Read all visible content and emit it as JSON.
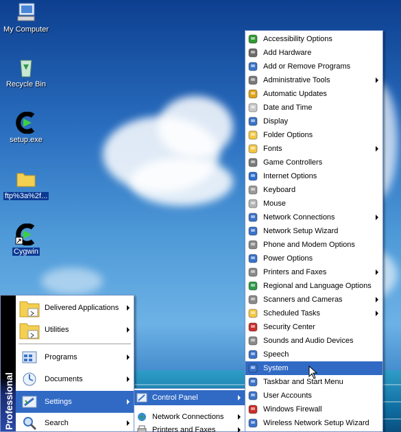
{
  "desktop": {
    "icons": [
      {
        "label": "My Computer",
        "icon": "my-computer-icon",
        "selected": false
      },
      {
        "label": "Recycle Bin",
        "icon": "recycle-bin-icon",
        "selected": false
      },
      {
        "label": "setup.exe",
        "icon": "cygwin-setup-icon",
        "selected": false
      },
      {
        "label": "ftp%3a%2f...",
        "icon": "folder-icon",
        "selected": true
      },
      {
        "label": "Cygwin",
        "icon": "cygwin-shortcut-icon",
        "selected": true
      }
    ]
  },
  "start_menu": {
    "band_text": "Professional",
    "items": [
      {
        "label": "Delivered Applications",
        "icon": "folder-icon",
        "submenu": true
      },
      {
        "label": "Utilities",
        "icon": "folder-icon",
        "submenu": true
      },
      {
        "label": "Programs",
        "icon": "programs-icon",
        "submenu": true
      },
      {
        "label": "Documents",
        "icon": "documents-icon",
        "submenu": true
      },
      {
        "label": "Settings",
        "icon": "settings-icon",
        "submenu": true,
        "highlighted": true
      },
      {
        "label": "Search",
        "icon": "search-icon",
        "submenu": true
      }
    ]
  },
  "settings_menu": {
    "items": [
      {
        "label": "Control Panel",
        "icon": "control-panel-icon",
        "submenu": true,
        "highlighted": true
      },
      {
        "label": "Network Connections",
        "icon": "network-icon",
        "submenu": true
      },
      {
        "label": "Printers and Faxes",
        "icon": "printer-icon",
        "submenu": true
      }
    ]
  },
  "control_panel_menu": {
    "items": [
      {
        "label": "Accessibility Options",
        "icon": "accessibility-icon",
        "color": "#2f9a2f",
        "submenu": false
      },
      {
        "label": "Add Hardware",
        "icon": "add-hardware-icon",
        "color": "#6b6b6b",
        "submenu": false
      },
      {
        "label": "Add or Remove Programs",
        "icon": "add-remove-programs-icon",
        "color": "#3a73c9",
        "submenu": false
      },
      {
        "label": "Administrative Tools",
        "icon": "admin-tools-icon",
        "color": "#7a7a7a",
        "submenu": true
      },
      {
        "label": "Automatic Updates",
        "icon": "automatic-updates-icon",
        "color": "#e0a21a",
        "submenu": false
      },
      {
        "label": "Date and Time",
        "icon": "date-time-icon",
        "color": "#c9c9c9",
        "submenu": false
      },
      {
        "label": "Display",
        "icon": "display-icon",
        "color": "#3a73c9",
        "submenu": false
      },
      {
        "label": "Folder Options",
        "icon": "folder-options-icon",
        "color": "#f3c843",
        "submenu": false
      },
      {
        "label": "Fonts",
        "icon": "fonts-icon",
        "color": "#f3c843",
        "submenu": true
      },
      {
        "label": "Game Controllers",
        "icon": "game-controllers-icon",
        "color": "#7a7a7a",
        "submenu": false
      },
      {
        "label": "Internet Options",
        "icon": "internet-options-icon",
        "color": "#2d6fd1",
        "submenu": false
      },
      {
        "label": "Keyboard",
        "icon": "keyboard-icon",
        "color": "#9a9a9a",
        "submenu": false
      },
      {
        "label": "Mouse",
        "icon": "mouse-icon",
        "color": "#b5b5b5",
        "submenu": false
      },
      {
        "label": "Network Connections",
        "icon": "network-connections-icon",
        "color": "#3a73c9",
        "submenu": true
      },
      {
        "label": "Network Setup Wizard",
        "icon": "network-setup-icon",
        "color": "#3a73c9",
        "submenu": false
      },
      {
        "label": "Phone and Modem Options",
        "icon": "phone-modem-icon",
        "color": "#8a8a8a",
        "submenu": false
      },
      {
        "label": "Power Options",
        "icon": "power-options-icon",
        "color": "#3a73c9",
        "submenu": false
      },
      {
        "label": "Printers and Faxes",
        "icon": "printers-faxes-icon",
        "color": "#8a8a8a",
        "submenu": true
      },
      {
        "label": "Regional and Language Options",
        "icon": "regional-icon",
        "color": "#2e9a4a",
        "submenu": false
      },
      {
        "label": "Scanners and Cameras",
        "icon": "scanners-icon",
        "color": "#8a8a8a",
        "submenu": true
      },
      {
        "label": "Scheduled Tasks",
        "icon": "scheduled-tasks-icon",
        "color": "#f3c843",
        "submenu": true
      },
      {
        "label": "Security Center",
        "icon": "security-center-icon",
        "color": "#c9302c",
        "submenu": false
      },
      {
        "label": "Sounds and Audio Devices",
        "icon": "sounds-icon",
        "color": "#8a8a8a",
        "submenu": false
      },
      {
        "label": "Speech",
        "icon": "speech-icon",
        "color": "#3a73c9",
        "submenu": false
      },
      {
        "label": "System",
        "icon": "system-icon",
        "color": "#3a73c9",
        "submenu": false,
        "highlighted": true
      },
      {
        "label": "Taskbar and Start Menu",
        "icon": "taskbar-icon",
        "color": "#3a73c9",
        "submenu": false
      },
      {
        "label": "User Accounts",
        "icon": "user-accounts-icon",
        "color": "#3a73c9",
        "submenu": false
      },
      {
        "label": "Windows Firewall",
        "icon": "firewall-icon",
        "color": "#c9302c",
        "submenu": false
      },
      {
        "label": "Wireless Network Setup Wizard",
        "icon": "wireless-setup-icon",
        "color": "#3a73c9",
        "submenu": false
      }
    ]
  }
}
